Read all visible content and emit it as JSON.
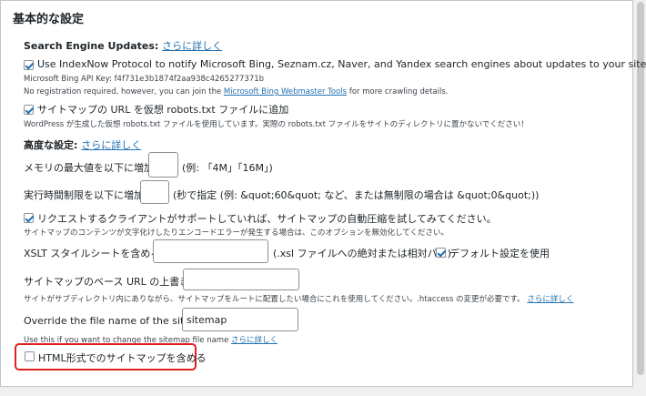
{
  "heading": "基本的な設定",
  "search_engine": {
    "label": "Search Engine Updates:",
    "more_link": "さらに詳しく",
    "indexnow_label": "Use IndexNow Protocol to notify Microsoft Bing, Seznam.cz, Naver, and Yandex search engines about updates to your site",
    "api_key_line": "Microsoft Bing API Key: f4f731e3b1874f2aa938c4265277371b",
    "no_reg_prefix": "No registration required, however, you can join the ",
    "webmaster_link": "Microsoft Bing Webmaster Tools",
    "no_reg_suffix": " for more crawling details.",
    "robots_label": "サイトマップの URL を仮想 robots.txt ファイルに追加",
    "robots_desc": "WordPress が生成した仮想 robots.txt ファイルを使用しています。実際の robots.txt ファイルをサイトのディレクトリに置かないでください！"
  },
  "advanced": {
    "label": "高度な設定:",
    "more_link": "さらに詳しく",
    "memory_label": "メモリの最大値を以下に増加:",
    "memory_value": "",
    "memory_hint": "(例: 「4M」「16M」)",
    "time_label": "実行時間制限を以下に増加:",
    "time_value": "",
    "time_hint": "(秒で指定 (例: &quot;60&quot; など、または無制限の場合は &quot;0&quot;))",
    "compress_label": "リクエストするクライアントがサポートしていれば、サイトマップの自動圧縮を試してみてください。",
    "compress_desc": "サイトマップのコンテンツが文字化けしたりエンコードエラーが発生する場合は、このオプションを無効化してください。",
    "xslt_label": "XSLT スタイルシートを含める:",
    "xslt_value": "",
    "xslt_hint": "(.xsl ファイルへの絶対または相対パス)",
    "default_label": "デフォルト設定を使用",
    "base_url_label": "サイトマップのベース URL の上書き :",
    "base_url_value": "",
    "base_url_desc": "サイトがサブディレクトリ内にありながら、サイトマップをルートに配置したい場合にこれを使用してください。.htaccess の変更が必要です。",
    "base_url_link": "さらに詳しく",
    "filename_label": "Override the file name of the sitemap:",
    "filename_value": "sitemap",
    "filename_desc": "Use this if you want to change the sitemap file name",
    "filename_link": "さらに詳しく",
    "html_label": "HTML形式でのサイトマップを含める"
  },
  "checkbox_states": {
    "indexnow": true,
    "robots": true,
    "compress": true,
    "default_xslt": true,
    "html_sitemap": false
  },
  "colors": {
    "link": "#2271b1",
    "highlight": "#e02020"
  }
}
